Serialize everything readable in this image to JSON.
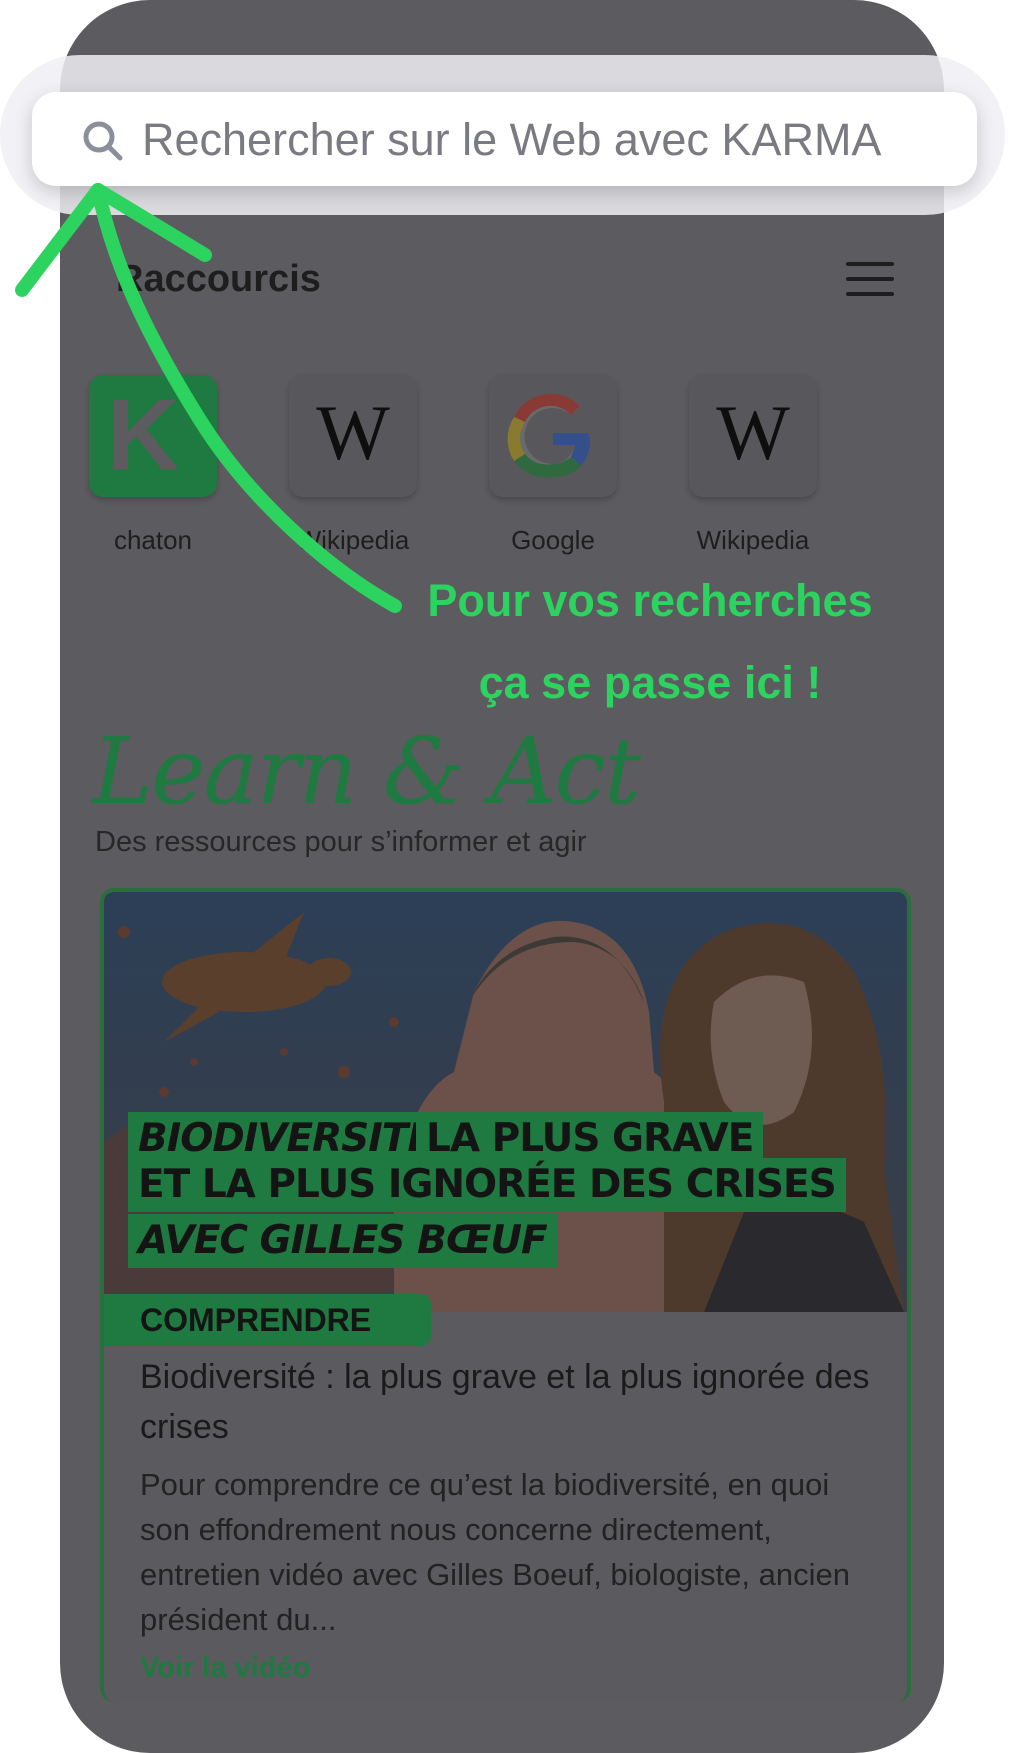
{
  "search": {
    "placeholder": "Rechercher sur le Web avec KARMA"
  },
  "shortcuts_section": {
    "title": "Raccourcis"
  },
  "shortcuts": [
    {
      "label": "chaton",
      "icon": "karma-k-logo"
    },
    {
      "label": "Wikipedia",
      "icon": "wikipedia-w-logo"
    },
    {
      "label": "Google",
      "icon": "google-g-logo"
    },
    {
      "label": "Wikipedia",
      "icon": "wikipedia-w-logo"
    }
  ],
  "annotation": {
    "line1": "Pour vos recherches",
    "line2": "ça se passe ici !"
  },
  "learn": {
    "title": "Learn & Act",
    "subtitle": "Des ressources pour s’informer et agir"
  },
  "card": {
    "image_text": {
      "line1a": "BIODIVERSITÉ →",
      "line1b": "LA PLUS GRAVE",
      "line2": "ET LA PLUS IGNORÉE DES CRISES",
      "line3": "AVEC GILLES BŒUF"
    },
    "badge": "COMPRENDRE",
    "title": "Biodiversité : la plus grave et la plus ignorée des crises",
    "description": "Pour comprendre ce qu’est la biodiversité, en quoi son effondrement nous concerne directement, entretien vidéo avec Gilles Boeuf, biologiste, ancien président du...",
    "link": "Voir la vidéo"
  },
  "colors": {
    "overlay": "#5c5b5f",
    "brand_green": "#1e7a40",
    "annotation_green": "#2dd35f"
  }
}
